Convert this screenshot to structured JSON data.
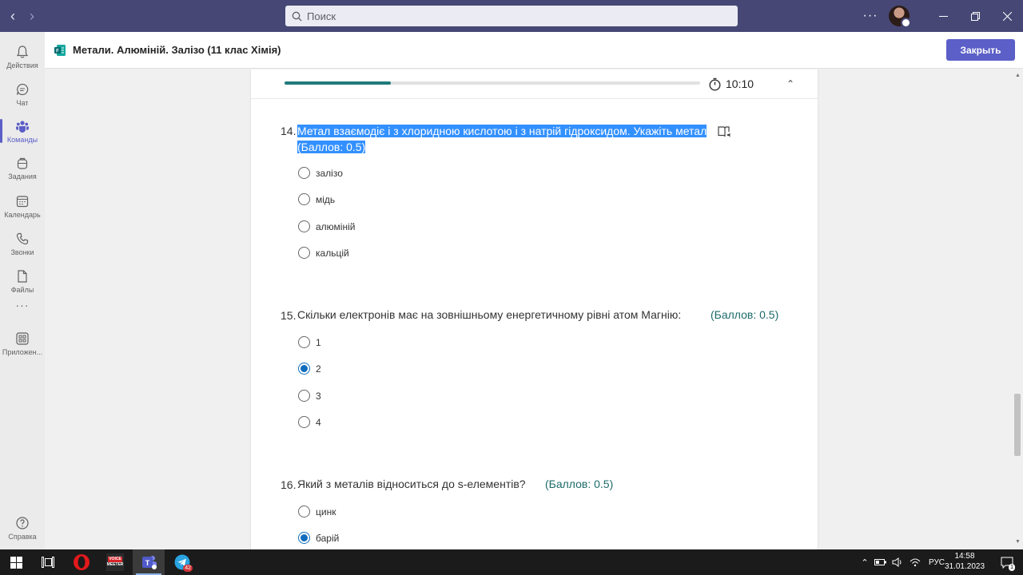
{
  "window": {
    "search_placeholder": "Поиск",
    "more_label": "···"
  },
  "rail": {
    "items": [
      {
        "label": "Действия"
      },
      {
        "label": "Чат"
      },
      {
        "label": "Команды"
      },
      {
        "label": "Задания"
      },
      {
        "label": "Календарь"
      },
      {
        "label": "Звонки"
      },
      {
        "label": "Файлы"
      },
      {
        "label": "Приложен..."
      },
      {
        "label": "Справка"
      }
    ],
    "more": "···"
  },
  "app": {
    "title": "Метали. Алюміній. Залізо (11 клас Хімія)",
    "close_label": "Закрыть"
  },
  "quiz": {
    "progress": 0.255,
    "timer": "10:10",
    "questions": [
      {
        "number": "14.",
        "text": "Метал взаємодіє і з хлоридною кислотою і з натрій гідроксидом. Укажіть метал",
        "points": "(Баллов: 0.5)",
        "options": [
          "залізо",
          "мідь",
          "алюміній",
          "кальцій"
        ],
        "selected": null
      },
      {
        "number": "15.",
        "text": "Скільки електронів має на зовнішньому енергетичному рівні атом Магнію:",
        "points": "(Баллов: 0.5)",
        "options": [
          "1",
          "2",
          "3",
          "4"
        ],
        "selected": 1
      },
      {
        "number": "16.",
        "text": "Який з металів відноситься до s-елементів?",
        "points": "(Баллов: 0.5)",
        "options": [
          "цинк",
          "барій"
        ],
        "selected": 1
      }
    ]
  },
  "taskbar": {
    "voicemeeter_line1": "VOICE",
    "voicemeeter_line2": "MEETER",
    "telegram_badge": "42",
    "lang": "РУС",
    "time": "14:58",
    "date": "31.01.2023",
    "notif_count": "1"
  },
  "colors": {
    "titlebar": "#464775",
    "accent": "#5b5fc7",
    "progress": "#1f7a7a",
    "points": "#1e6b6b",
    "radio_selected": "#0f6cbd",
    "selection": "#3390ff"
  }
}
